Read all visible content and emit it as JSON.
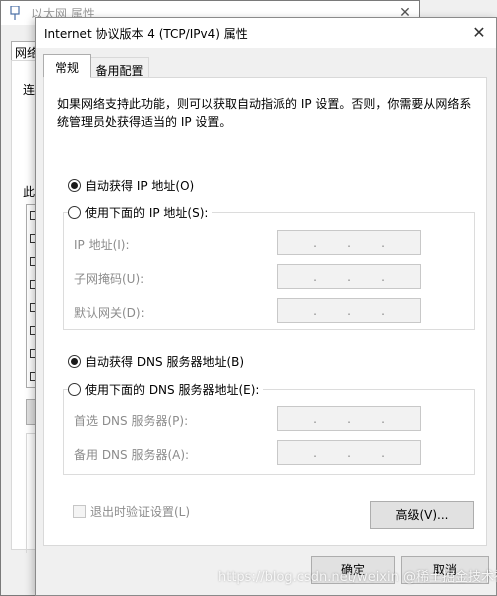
{
  "background_window": {
    "title": "以太网 属性",
    "close": "✕",
    "tab_label": "网络",
    "label_connect": "连",
    "label_uses": "此"
  },
  "dialog": {
    "title": "Internet 协议版本 4 (TCP/IPv4) 属性",
    "close": "✕",
    "tabs": [
      {
        "label": "常规",
        "active": true
      },
      {
        "label": "备用配置",
        "active": false
      }
    ],
    "description": "如果网络支持此功能，则可以获取自动指派的 IP 设置。否则，你需要从网络系统管理员处获得适当的 IP 设置。",
    "ip_options": {
      "auto_label": "自动获得 IP 地址(O)",
      "manual_label": "使用下面的 IP 地址(S):",
      "selected": "auto"
    },
    "ip_fields": [
      {
        "label": "IP 地址(I):",
        "value": ". . ."
      },
      {
        "label": "子网掩码(U):",
        "value": ". . ."
      },
      {
        "label": "默认网关(D):",
        "value": ". . ."
      }
    ],
    "dns_options": {
      "auto_label": "自动获得 DNS 服务器地址(B)",
      "manual_label": "使用下面的 DNS 服务器地址(E):",
      "selected": "auto"
    },
    "dns_fields": [
      {
        "label": "首选 DNS 服务器(P):",
        "value": ". . ."
      },
      {
        "label": "备用 DNS 服务器(A):",
        "value": ". . ."
      }
    ],
    "validate_checkbox": {
      "label": "退出时验证设置(L)",
      "checked": false
    },
    "buttons": {
      "advanced": "高级(V)...",
      "ok": "确定",
      "cancel": "取消"
    }
  },
  "watermark": "https://blog.csdn.net/weixin @稀土掘金技术社区",
  "colors": {
    "dialog_bg": "#f0f0f0",
    "panel_bg": "#ffffff",
    "disabled_text": "#8c8c8c",
    "button_bg": "#e1e1e1"
  }
}
